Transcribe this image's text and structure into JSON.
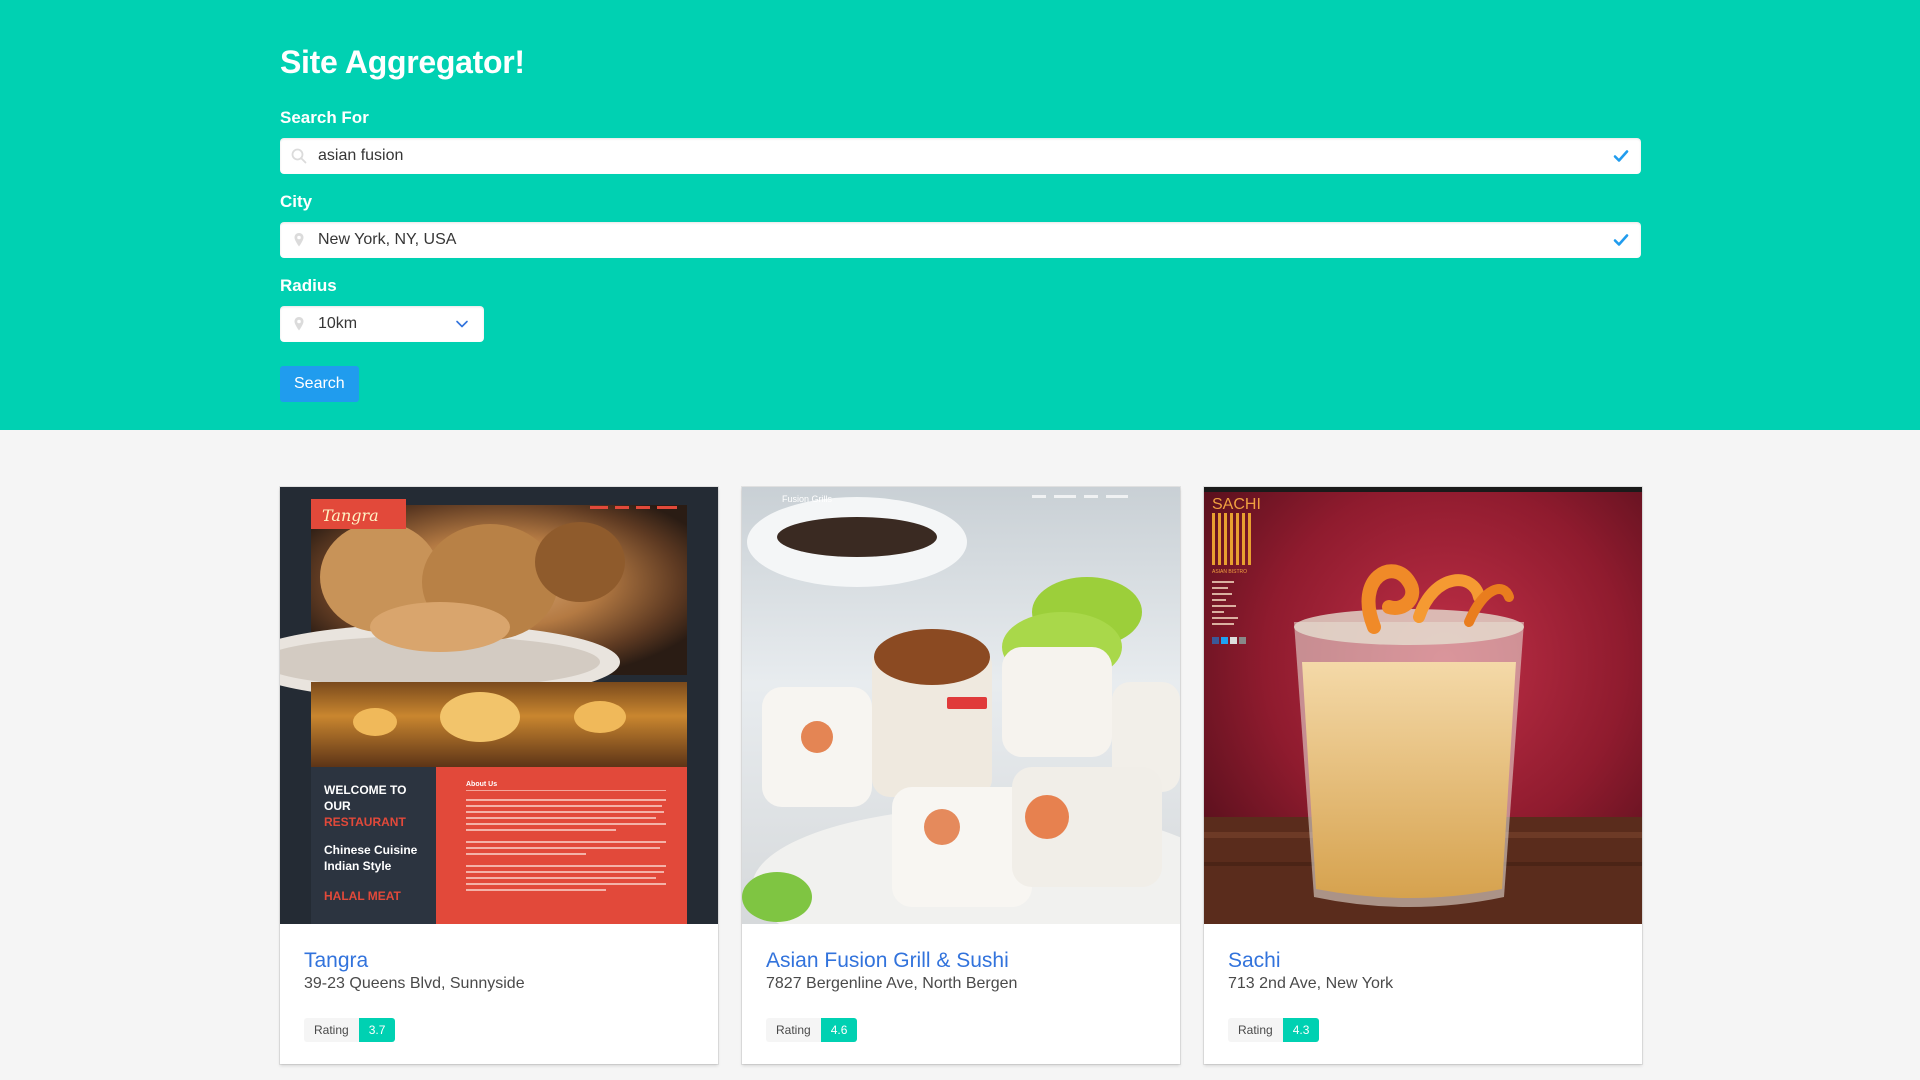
{
  "app_title": "Site Aggregator!",
  "form": {
    "search_label": "Search For",
    "search_value": "asian fusion",
    "city_label": "City",
    "city_value": "New York, NY, USA",
    "radius_label": "Radius",
    "radius_value": "10km",
    "search_button": "Search"
  },
  "colors": {
    "primary": "#00d1b2",
    "link": "#3273dc",
    "button": "#209cee"
  },
  "results": [
    {
      "name": "Tangra",
      "address": "39-23 Queens Blvd, Sunnyside",
      "rating_label": "Rating",
      "rating": "3.7",
      "thumb": {
        "logo": "Tangra",
        "welcome_1": "WELCOME TO",
        "welcome_2": "OUR",
        "welcome_3": "RESTAURANT",
        "cuisine_1": "Chinese Cuisine",
        "cuisine_2": "Indian Style",
        "halal": "HALAL MEAT",
        "about": "About Us"
      }
    },
    {
      "name": "Asian Fusion Grill & Sushi",
      "address": "7827 Bergenline Ave, North Bergen",
      "rating_label": "Rating",
      "rating": "4.6",
      "thumb": {
        "logo": "Fusion Grills"
      }
    },
    {
      "name": "Sachi",
      "address": "713 2nd Ave, New York",
      "rating_label": "Rating",
      "rating": "4.3",
      "thumb": {
        "logo": "SACHI",
        "sub": "ASIAN BISTRO"
      }
    }
  ]
}
